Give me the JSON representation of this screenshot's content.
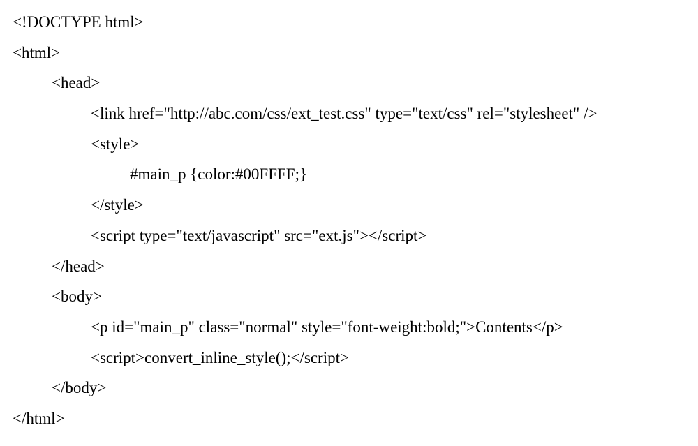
{
  "lines": [
    {
      "indent": 0,
      "text": "<!DOCTYPE html>"
    },
    {
      "indent": 0,
      "text": "<html>"
    },
    {
      "indent": 1,
      "text": "<head>"
    },
    {
      "indent": 2,
      "text": "<link href=\"http://abc.com/css/ext_test.css\" type=\"text/css\" rel=\"stylesheet\" />"
    },
    {
      "indent": 2,
      "text": "<style>"
    },
    {
      "indent": 3,
      "text": "#main_p {color:#00FFFF;}"
    },
    {
      "indent": 2,
      "text": "</style>"
    },
    {
      "indent": 2,
      "text": "<script type=\"text/javascript\" src=\"ext.js\"></script>"
    },
    {
      "indent": 1,
      "text": "</head>"
    },
    {
      "indent": 1,
      "text": "<body>"
    },
    {
      "indent": 2,
      "text": "<p id=\"main_p\" class=\"normal\" style=\"font-weight:bold;\">Contents</p>"
    },
    {
      "indent": 2,
      "text": "<script>convert_inline_style();</script>"
    },
    {
      "indent": 1,
      "text": "</body>"
    },
    {
      "indent": 0,
      "text": "</html>"
    }
  ]
}
